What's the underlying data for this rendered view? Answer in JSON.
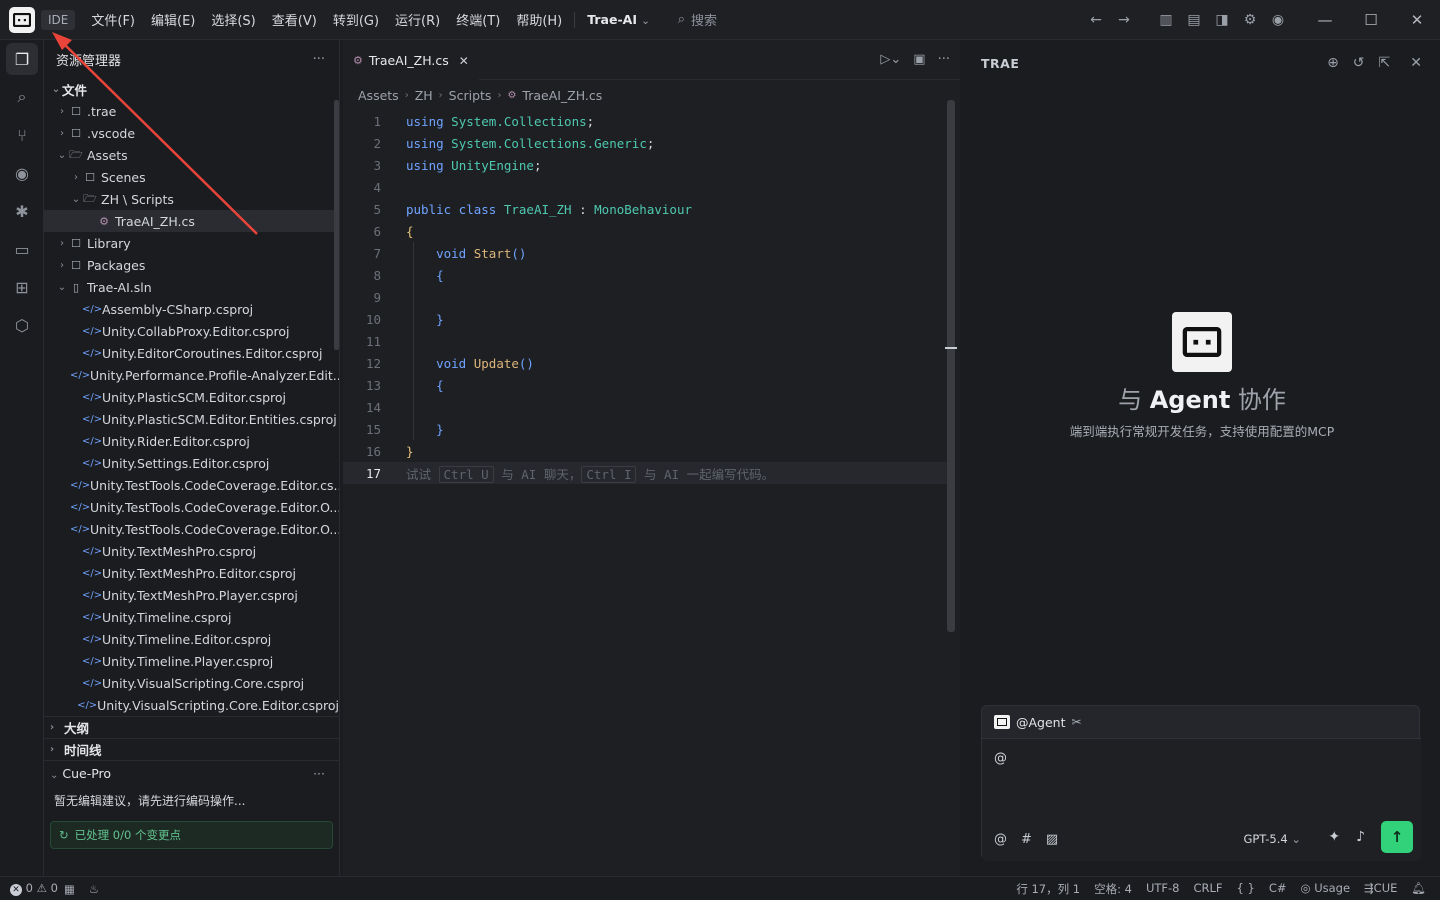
{
  "titlebar": {
    "ide_tag": "IDE",
    "menu": [
      "文件(F)",
      "编辑(E)",
      "选择(S)",
      "查看(V)",
      "转到(G)",
      "运行(R)",
      "终端(T)",
      "帮助(H)"
    ],
    "project": "Trae-AI",
    "search_label": "搜索"
  },
  "explorer": {
    "title": "资源管理器",
    "root_label": "文件",
    "tree": [
      {
        "label": ".trae",
        "indent": 1,
        "type": "folder",
        "open": false
      },
      {
        "label": ".vscode",
        "indent": 1,
        "type": "folder",
        "open": false
      },
      {
        "label": "Assets",
        "indent": 1,
        "type": "folder",
        "open": true
      },
      {
        "label": "Scenes",
        "indent": 2,
        "type": "folder",
        "open": false
      },
      {
        "label": "ZH \\ Scripts",
        "indent": 2,
        "type": "folder",
        "open": true
      },
      {
        "label": "TraeAI_ZH.cs",
        "indent": 3,
        "type": "cs",
        "active": true
      },
      {
        "label": "Library",
        "indent": 1,
        "type": "folder",
        "open": false
      },
      {
        "label": "Packages",
        "indent": 1,
        "type": "folder",
        "open": false
      },
      {
        "label": "Trae-AI.sln",
        "indent": 1,
        "type": "sln",
        "open": true
      },
      {
        "label": "Assembly-CSharp.csproj",
        "indent": 2,
        "type": "xml"
      },
      {
        "label": "Unity.CollabProxy.Editor.csproj",
        "indent": 2,
        "type": "xml"
      },
      {
        "label": "Unity.EditorCoroutines.Editor.csproj",
        "indent": 2,
        "type": "xml"
      },
      {
        "label": "Unity.Performance.Profile-Analyzer.Edit...",
        "indent": 2,
        "type": "xml"
      },
      {
        "label": "Unity.PlasticSCM.Editor.csproj",
        "indent": 2,
        "type": "xml"
      },
      {
        "label": "Unity.PlasticSCM.Editor.Entities.csproj",
        "indent": 2,
        "type": "xml"
      },
      {
        "label": "Unity.Rider.Editor.csproj",
        "indent": 2,
        "type": "xml"
      },
      {
        "label": "Unity.Settings.Editor.csproj",
        "indent": 2,
        "type": "xml"
      },
      {
        "label": "Unity.TestTools.CodeCoverage.Editor.cs...",
        "indent": 2,
        "type": "xml"
      },
      {
        "label": "Unity.TestTools.CodeCoverage.Editor.O...",
        "indent": 2,
        "type": "xml"
      },
      {
        "label": "Unity.TestTools.CodeCoverage.Editor.O...",
        "indent": 2,
        "type": "xml"
      },
      {
        "label": "Unity.TextMeshPro.csproj",
        "indent": 2,
        "type": "xml"
      },
      {
        "label": "Unity.TextMeshPro.Editor.csproj",
        "indent": 2,
        "type": "xml"
      },
      {
        "label": "Unity.TextMeshPro.Player.csproj",
        "indent": 2,
        "type": "xml"
      },
      {
        "label": "Unity.Timeline.csproj",
        "indent": 2,
        "type": "xml"
      },
      {
        "label": "Unity.Timeline.Editor.csproj",
        "indent": 2,
        "type": "xml"
      },
      {
        "label": "Unity.Timeline.Player.csproj",
        "indent": 2,
        "type": "xml"
      },
      {
        "label": "Unity.VisualScripting.Core.csproj",
        "indent": 2,
        "type": "xml"
      },
      {
        "label": "Unity.VisualScripting.Core.Editor.csproj",
        "indent": 2,
        "type": "xml"
      }
    ],
    "outline_label": "大纲",
    "timeline_label": "时间线",
    "cue_label": "Cue-Pro",
    "cue_message": "暂无编辑建议，请先进行编码操作...",
    "cue_status": "已处理 0/0 个变更点"
  },
  "editor": {
    "tab_label": "TraeAI_ZH.cs",
    "breadcrumb": [
      "Assets",
      "ZH",
      "Scripts",
      "TraeAI_ZH.cs"
    ],
    "current_line": 17,
    "hint": {
      "t1": "试试 ",
      "k1": "Ctrl U",
      "t2": " 与 AI 聊天，",
      "k2": "Ctrl I",
      "t3": " 与 AI 一起编写代码。"
    }
  },
  "trae": {
    "title": "TRAE",
    "hero_pre": "与 ",
    "hero_bold": "Agent",
    "hero_post": " 协作",
    "hero_sub": "端到端执行常规开发任务，支持使用配置的MCP",
    "agent_label": "@Agent",
    "input_value": "@",
    "model": "GPT-5.4"
  },
  "status": {
    "errors": "0",
    "warnings": "0",
    "cursor": "行 17，列 1",
    "spaces": "空格: 4",
    "encoding": "UTF-8",
    "eol": "CRLF",
    "braces": "{ }",
    "language": "C#",
    "usage": "Usage",
    "cue": "CUE"
  },
  "colors": {
    "accent_green": "#32d27a",
    "arrow_red": "#e8443a",
    "keyword": "#6fa3ff",
    "type": "#4ec9b0"
  }
}
